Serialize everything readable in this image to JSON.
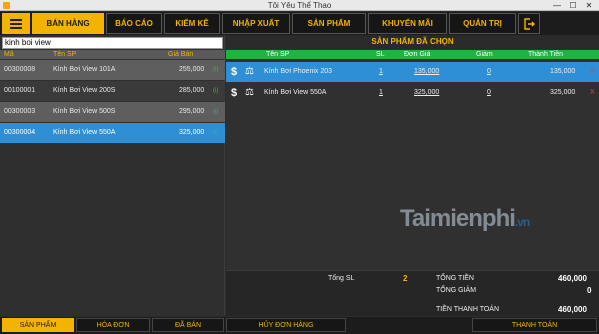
{
  "window": {
    "title": "Tôi Yêu Thể Thao",
    "min": "—",
    "max": "☐",
    "close": "✕"
  },
  "menu": {
    "items": [
      "BÁN HÀNG",
      "BÁO CÁO",
      "KIỂM KÊ",
      "NHẬP XUẤT",
      "SẢN PHẨM",
      "KHUYẾN MÃI",
      "QUẢN TRỊ"
    ],
    "active": "BÁN HÀNG"
  },
  "search": {
    "value": "kinh boi view"
  },
  "product_list": {
    "headers": {
      "ma": "Mã",
      "ten": "Tên SP",
      "gia": "Giá Bán"
    },
    "rows": [
      {
        "ma": "00300008",
        "ten": "Kính Bơi View 101A",
        "gia": "255,000",
        "chk": "(i)"
      },
      {
        "ma": "00100001",
        "ten": "Kính Bơi View 200S",
        "gia": "285,000",
        "chk": "(i)"
      },
      {
        "ma": "00300003",
        "ten": "Kính Bơi View 500S",
        "gia": "295,000",
        "chk": "(i)"
      },
      {
        "ma": "00300004",
        "ten": "Kính Bơi View 550A",
        "gia": "325,000",
        "chk": "(i)"
      }
    ]
  },
  "selected": {
    "title": "SẢN PHẨM ĐÃ CHỌN",
    "headers": {
      "ten": "Tên SP",
      "sl": "SL",
      "dongia": "Đơn Giá",
      "giam": "Giảm",
      "thanhtien": "Thành Tiền"
    },
    "rows": [
      {
        "dollar": "$",
        "ten": "Kính Bơi Phoenix 203",
        "sl": "1",
        "dongia": "135,000",
        "giam": "0",
        "thanhtien": "135,000",
        "del": "X"
      },
      {
        "dollar": "$",
        "ten": "Kính Bơi View 550A",
        "sl": "1",
        "dongia": "325,000",
        "giam": "0",
        "thanhtien": "325,000",
        "del": "X"
      }
    ]
  },
  "summary": {
    "tong_sl_label": "Tổng SL",
    "tong_sl": "2",
    "tong_tien_label": "TỔNG TIỀN",
    "tong_tien": "460,000",
    "tong_giam_label": "TỔNG GIẢM",
    "tong_giam": "0",
    "thanh_toan_label": "TIỀN THANH TOÁN",
    "thanh_toan": "460,000"
  },
  "bottom": {
    "san_pham": "SẢN PHẨM",
    "hoa_don": "HÓA ĐƠN",
    "da_ban": "ĐÃ BÁN",
    "huy_don": "HỦY ĐƠN HÀNG",
    "thanh_toan": "THANH TOÁN"
  },
  "watermark": {
    "main": "Taimienphi",
    "suffix": ".vn"
  },
  "colors": {
    "accent": "#f2b400",
    "header_green": "#21b33c",
    "selection_blue": "#2f8fd6"
  }
}
